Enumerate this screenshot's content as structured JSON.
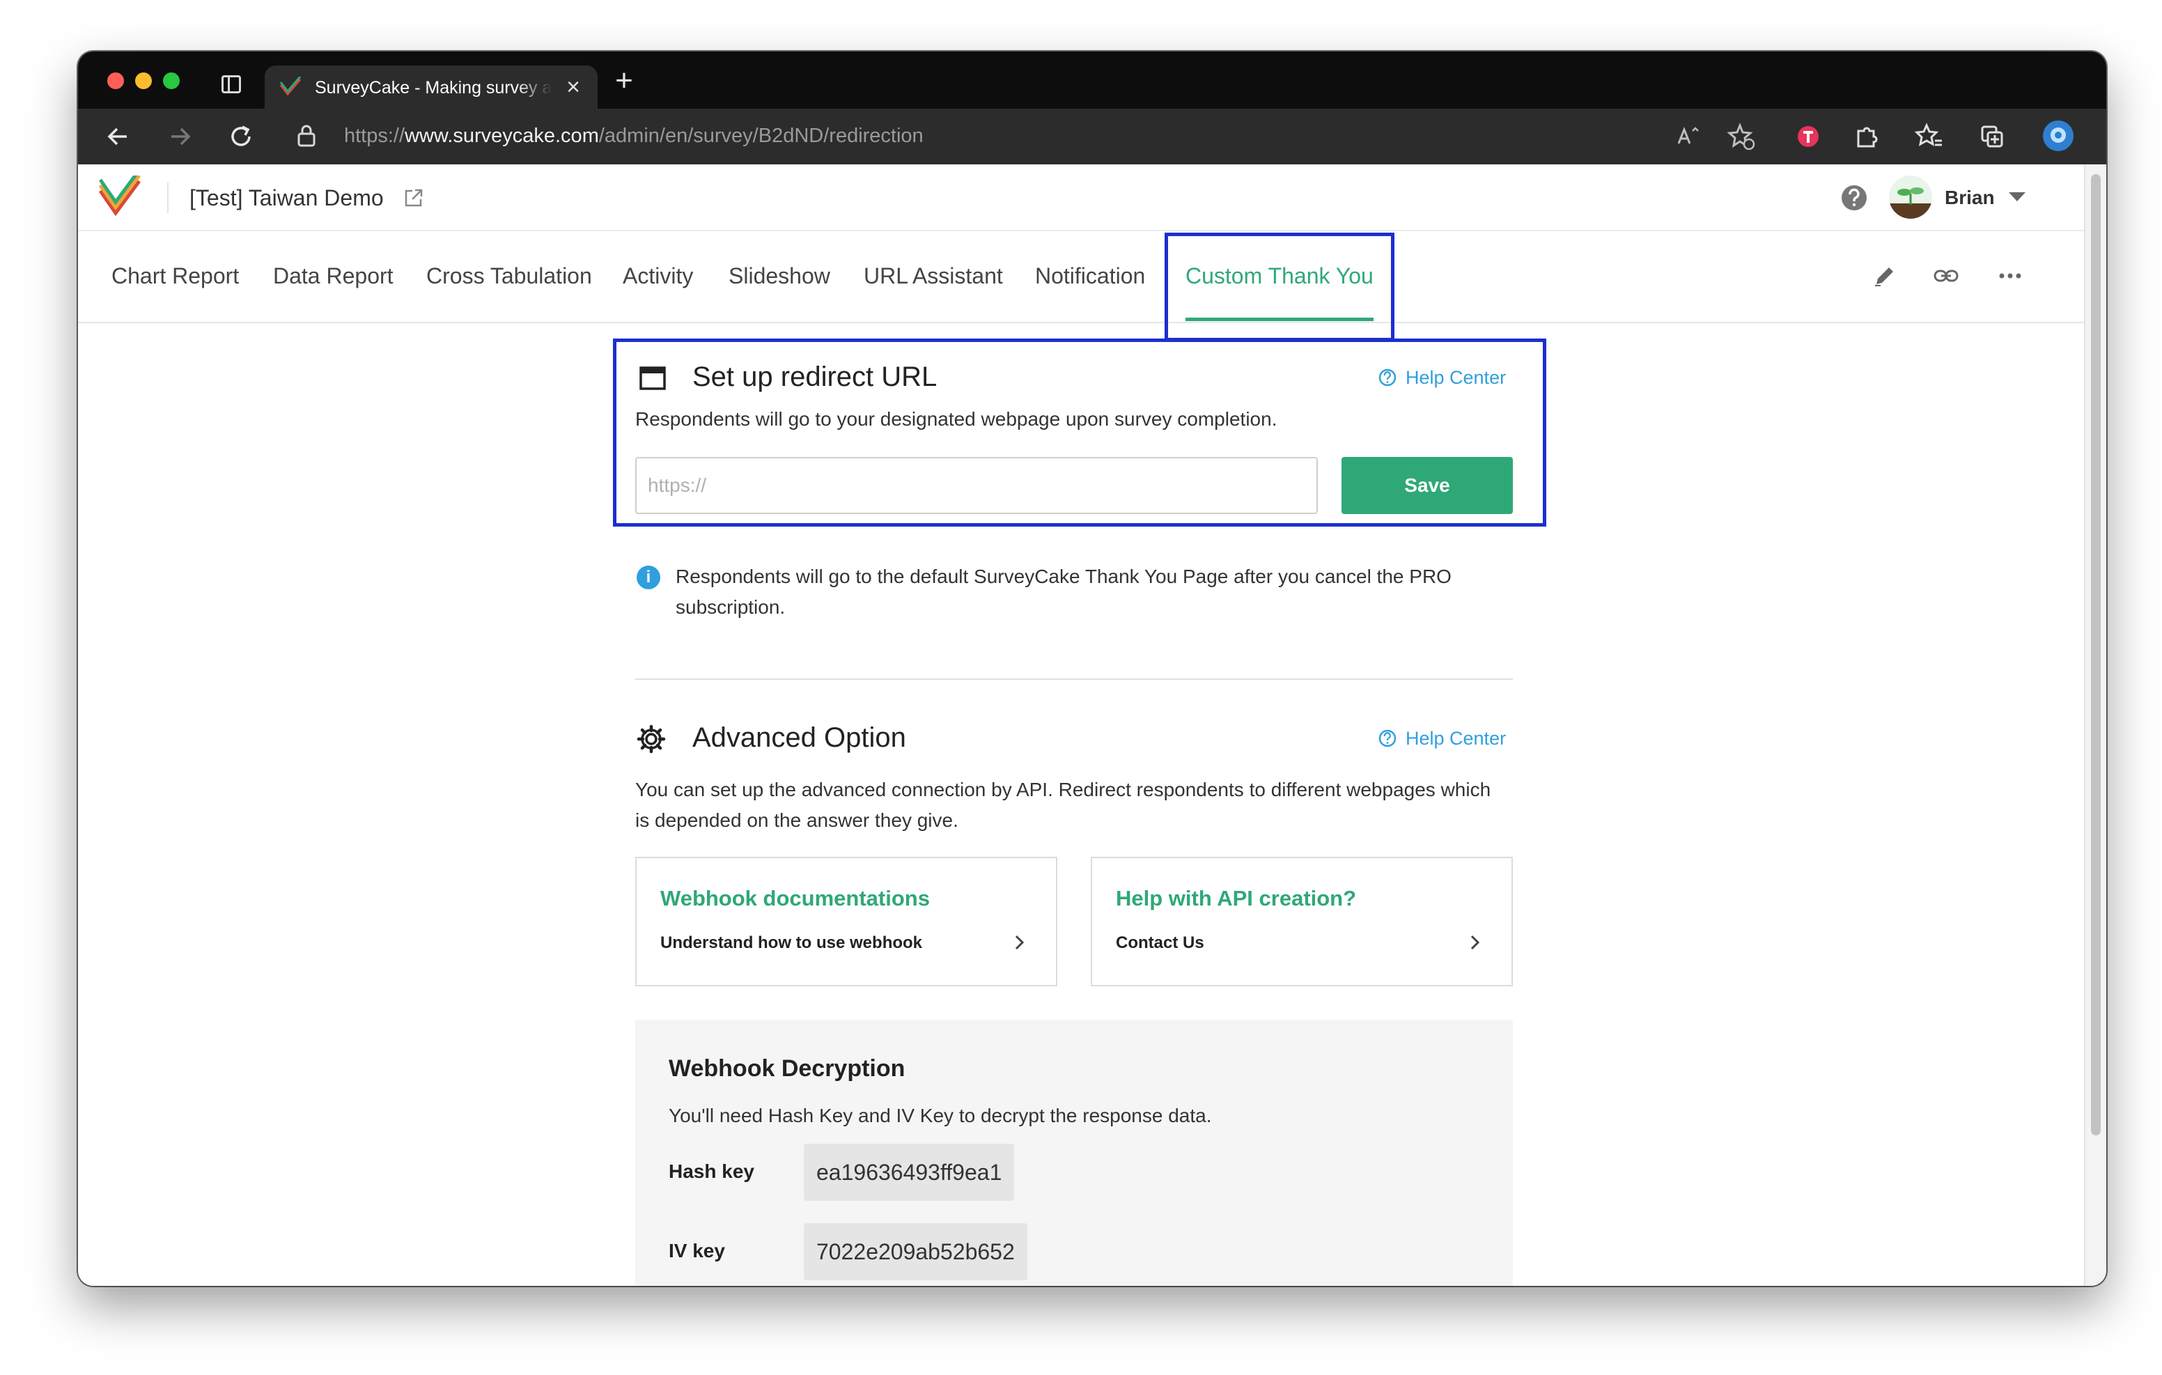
{
  "browser": {
    "tab_title": "SurveyCake - Making survey as easy as a piece of cake",
    "url_scheme": "https://",
    "url_host": "www.surveycake.com",
    "url_path": "/admin/en/survey/B2dND/redirection"
  },
  "header": {
    "survey_title": "[Test] Taiwan Demo",
    "user_name": "Brian"
  },
  "subnav": {
    "tabs": [
      {
        "label": "Chart Report"
      },
      {
        "label": "Data Report"
      },
      {
        "label": "Cross Tabulation"
      },
      {
        "label": "Activity"
      },
      {
        "label": "Slideshow"
      },
      {
        "label": "URL Assistant"
      },
      {
        "label": "Notification"
      },
      {
        "label": "Custom Thank You"
      }
    ],
    "active_index": 7
  },
  "redirect": {
    "title": "Set up redirect URL",
    "help_label": "Help Center",
    "description": "Respondents will go to your designated webpage upon survey completion.",
    "input_placeholder": "https://",
    "input_value": "",
    "save_label": "Save",
    "notice_line1": "Respondents will go to the default SurveyCake Thank You Page after you cancel the PRO",
    "notice_line2": "subscription."
  },
  "advanced": {
    "title": "Advanced Option",
    "help_label": "Help Center",
    "description_line1": "You can set up the advanced connection by API. Redirect respondents to different webpages which",
    "description_line2": "is depended on the answer they give.",
    "cards": [
      {
        "title": "Webhook documentations",
        "subtitle": "Understand how to use webhook"
      },
      {
        "title": "Help with API creation?",
        "subtitle": "Contact Us"
      }
    ]
  },
  "decryption": {
    "title": "Webhook Decryption",
    "description": "You'll need Hash Key and IV Key to decrypt the response data.",
    "hash_label": "Hash key",
    "hash_value": "ea19636493ff9ea1",
    "iv_label": "IV key",
    "iv_value": "7022e209ab52b652"
  },
  "colors": {
    "accent_green": "#2fa878",
    "link_blue": "#2f9fde",
    "highlight_blue": "#1b2fd0"
  }
}
